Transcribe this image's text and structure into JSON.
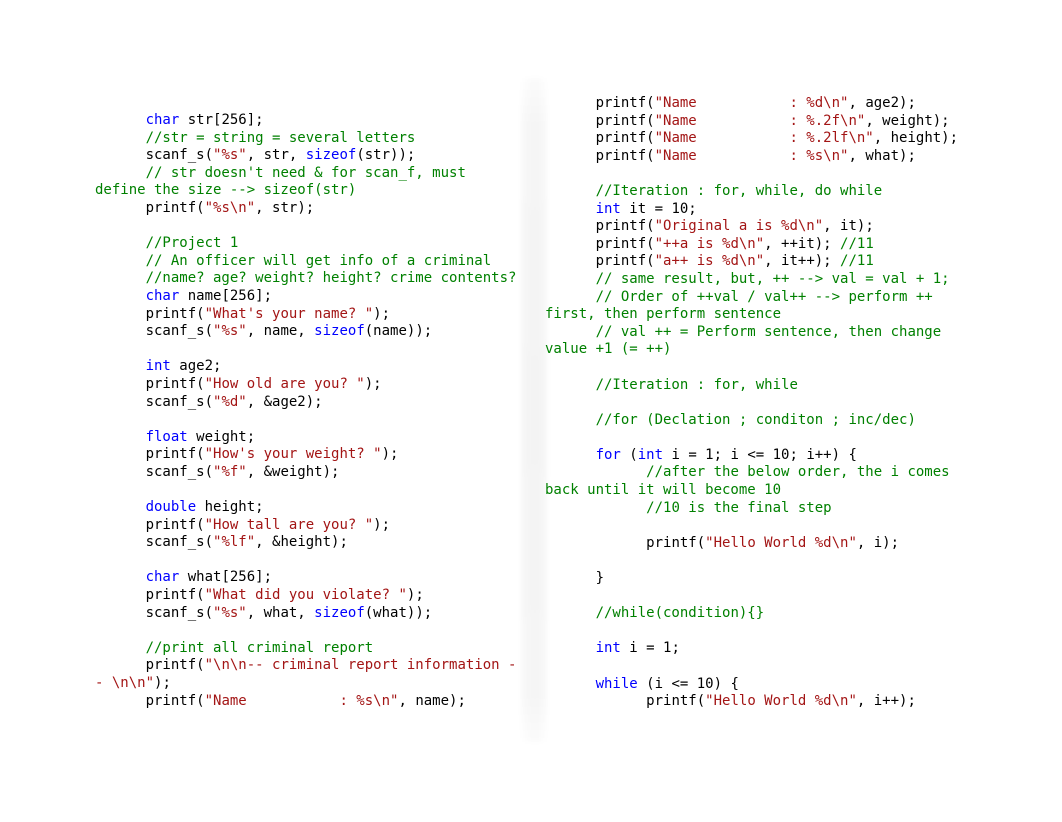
{
  "document": {
    "kind": "c-source-code-listing",
    "language": "C",
    "background_color": "#ffffff",
    "columns": 2
  },
  "theme": {
    "keyword_color": "#0000ff",
    "string_color": "#a31515",
    "comment_color": "#008000",
    "plain_color": "#000000",
    "background_color": "#ffffff"
  },
  "left_column": {
    "lines": [
      [
        {
          "t": "pln",
          "s": "      "
        },
        {
          "t": "kw",
          "s": "char"
        },
        {
          "t": "pln",
          "s": " str[256];"
        }
      ],
      [
        {
          "t": "pln",
          "s": "      "
        },
        {
          "t": "cmt",
          "s": "//str = string = several letters"
        }
      ],
      [
        {
          "t": "pln",
          "s": "      scanf_s("
        },
        {
          "t": "str",
          "s": "\"%s\""
        },
        {
          "t": "pln",
          "s": ", str, "
        },
        {
          "t": "kw",
          "s": "sizeof"
        },
        {
          "t": "pln",
          "s": "(str));"
        }
      ],
      [
        {
          "t": "pln",
          "s": "      "
        },
        {
          "t": "cmt",
          "s": "// str doesn't need & for scan_f, must define the size --> sizeof(str)"
        }
      ],
      [
        {
          "t": "pln",
          "s": "      printf("
        },
        {
          "t": "str",
          "s": "\"%s\\n\""
        },
        {
          "t": "pln",
          "s": ", str);"
        }
      ],
      [
        {
          "t": "pln",
          "s": ""
        }
      ],
      [
        {
          "t": "pln",
          "s": "      "
        },
        {
          "t": "cmt",
          "s": "//Project 1"
        }
      ],
      [
        {
          "t": "pln",
          "s": "      "
        },
        {
          "t": "cmt",
          "s": "// An officer will get info of a criminal"
        }
      ],
      [
        {
          "t": "pln",
          "s": "      "
        },
        {
          "t": "cmt",
          "s": "//name? age? weight? height? crime contents?"
        }
      ],
      [
        {
          "t": "pln",
          "s": "      "
        },
        {
          "t": "kw",
          "s": "char"
        },
        {
          "t": "pln",
          "s": " name[256];"
        }
      ],
      [
        {
          "t": "pln",
          "s": "      printf("
        },
        {
          "t": "str",
          "s": "\"What's your name? \""
        },
        {
          "t": "pln",
          "s": ");"
        }
      ],
      [
        {
          "t": "pln",
          "s": "      scanf_s("
        },
        {
          "t": "str",
          "s": "\"%s\""
        },
        {
          "t": "pln",
          "s": ", name, "
        },
        {
          "t": "kw",
          "s": "sizeof"
        },
        {
          "t": "pln",
          "s": "(name));"
        }
      ],
      [
        {
          "t": "pln",
          "s": ""
        }
      ],
      [
        {
          "t": "pln",
          "s": "      "
        },
        {
          "t": "kw",
          "s": "int"
        },
        {
          "t": "pln",
          "s": " age2;"
        }
      ],
      [
        {
          "t": "pln",
          "s": "      printf("
        },
        {
          "t": "str",
          "s": "\"How old are you? \""
        },
        {
          "t": "pln",
          "s": ");"
        }
      ],
      [
        {
          "t": "pln",
          "s": "      scanf_s("
        },
        {
          "t": "str",
          "s": "\"%d\""
        },
        {
          "t": "pln",
          "s": ", &age2);"
        }
      ],
      [
        {
          "t": "pln",
          "s": ""
        }
      ],
      [
        {
          "t": "pln",
          "s": "      "
        },
        {
          "t": "kw",
          "s": "float"
        },
        {
          "t": "pln",
          "s": " weight;"
        }
      ],
      [
        {
          "t": "pln",
          "s": "      printf("
        },
        {
          "t": "str",
          "s": "\"How's your weight? \""
        },
        {
          "t": "pln",
          "s": ");"
        }
      ],
      [
        {
          "t": "pln",
          "s": "      scanf_s("
        },
        {
          "t": "str",
          "s": "\"%f\""
        },
        {
          "t": "pln",
          "s": ", &weight);"
        }
      ],
      [
        {
          "t": "pln",
          "s": ""
        }
      ],
      [
        {
          "t": "pln",
          "s": "      "
        },
        {
          "t": "kw",
          "s": "double"
        },
        {
          "t": "pln",
          "s": " height;"
        }
      ],
      [
        {
          "t": "pln",
          "s": "      printf("
        },
        {
          "t": "str",
          "s": "\"How tall are you? \""
        },
        {
          "t": "pln",
          "s": ");"
        }
      ],
      [
        {
          "t": "pln",
          "s": "      scanf_s("
        },
        {
          "t": "str",
          "s": "\"%lf\""
        },
        {
          "t": "pln",
          "s": ", &height);"
        }
      ],
      [
        {
          "t": "pln",
          "s": ""
        }
      ],
      [
        {
          "t": "pln",
          "s": "      "
        },
        {
          "t": "kw",
          "s": "char"
        },
        {
          "t": "pln",
          "s": " what[256];"
        }
      ],
      [
        {
          "t": "pln",
          "s": "      printf("
        },
        {
          "t": "str",
          "s": "\"What did you violate? \""
        },
        {
          "t": "pln",
          "s": ");"
        }
      ],
      [
        {
          "t": "pln",
          "s": "      scanf_s("
        },
        {
          "t": "str",
          "s": "\"%s\""
        },
        {
          "t": "pln",
          "s": ", what, "
        },
        {
          "t": "kw",
          "s": "sizeof"
        },
        {
          "t": "pln",
          "s": "(what));"
        }
      ],
      [
        {
          "t": "pln",
          "s": ""
        }
      ],
      [
        {
          "t": "pln",
          "s": "      "
        },
        {
          "t": "cmt",
          "s": "//print all criminal report"
        }
      ],
      [
        {
          "t": "pln",
          "s": "      printf("
        },
        {
          "t": "str",
          "s": "\"\\n\\n-- criminal report information -- \\n\\n\""
        },
        {
          "t": "pln",
          "s": ");"
        }
      ],
      [
        {
          "t": "pln",
          "s": "      printf("
        },
        {
          "t": "str",
          "s": "\"Name           : %s\\n\""
        },
        {
          "t": "pln",
          "s": ", name);"
        }
      ]
    ]
  },
  "right_column": {
    "lines": [
      [
        {
          "t": "pln",
          "s": "      printf("
        },
        {
          "t": "str",
          "s": "\"Name           : %d\\n\""
        },
        {
          "t": "pln",
          "s": ", age2);"
        }
      ],
      [
        {
          "t": "pln",
          "s": "      printf("
        },
        {
          "t": "str",
          "s": "\"Name           : %.2f\\n\""
        },
        {
          "t": "pln",
          "s": ", weight);"
        }
      ],
      [
        {
          "t": "pln",
          "s": "      printf("
        },
        {
          "t": "str",
          "s": "\"Name           : %.2lf\\n\""
        },
        {
          "t": "pln",
          "s": ", height);"
        }
      ],
      [
        {
          "t": "pln",
          "s": "      printf("
        },
        {
          "t": "str",
          "s": "\"Name           : %s\\n\""
        },
        {
          "t": "pln",
          "s": ", what);"
        }
      ],
      [
        {
          "t": "pln",
          "s": ""
        }
      ],
      [
        {
          "t": "pln",
          "s": "      "
        },
        {
          "t": "cmt",
          "s": "//Iteration : for, while, do while"
        }
      ],
      [
        {
          "t": "pln",
          "s": "      "
        },
        {
          "t": "kw",
          "s": "int"
        },
        {
          "t": "pln",
          "s": " it = 10;"
        }
      ],
      [
        {
          "t": "pln",
          "s": "      printf("
        },
        {
          "t": "str",
          "s": "\"Original a is %d\\n\""
        },
        {
          "t": "pln",
          "s": ", it);"
        }
      ],
      [
        {
          "t": "pln",
          "s": "      printf("
        },
        {
          "t": "str",
          "s": "\"++a is %d\\n\""
        },
        {
          "t": "pln",
          "s": ", ++it); "
        },
        {
          "t": "cmt",
          "s": "//11"
        }
      ],
      [
        {
          "t": "pln",
          "s": "      printf("
        },
        {
          "t": "str",
          "s": "\"a++ is %d\\n\""
        },
        {
          "t": "pln",
          "s": ", it++); "
        },
        {
          "t": "cmt",
          "s": "//11"
        }
      ],
      [
        {
          "t": "pln",
          "s": "      "
        },
        {
          "t": "cmt",
          "s": "// same result, but, ++ --> val = val + 1;"
        }
      ],
      [
        {
          "t": "pln",
          "s": "      "
        },
        {
          "t": "cmt",
          "s": "// Order of ++val / val++ --> perform ++ first, then perform sentence"
        }
      ],
      [
        {
          "t": "pln",
          "s": "      "
        },
        {
          "t": "cmt",
          "s": "// val ++ = Perform sentence, then change value +1 (= ++)"
        }
      ],
      [
        {
          "t": "pln",
          "s": ""
        }
      ],
      [
        {
          "t": "pln",
          "s": "      "
        },
        {
          "t": "cmt",
          "s": "//Iteration : for, while"
        }
      ],
      [
        {
          "t": "pln",
          "s": ""
        }
      ],
      [
        {
          "t": "pln",
          "s": "      "
        },
        {
          "t": "cmt",
          "s": "//for (Declation ; conditon ; inc/dec)"
        }
      ],
      [
        {
          "t": "pln",
          "s": ""
        }
      ],
      [
        {
          "t": "pln",
          "s": "      "
        },
        {
          "t": "kw",
          "s": "for"
        },
        {
          "t": "pln",
          "s": " ("
        },
        {
          "t": "kw",
          "s": "int"
        },
        {
          "t": "pln",
          "s": " i = 1; i <= 10; i++) {"
        }
      ],
      [
        {
          "t": "pln",
          "s": "            "
        },
        {
          "t": "cmt",
          "s": "//after the below order, the i comes back until it will become 10"
        }
      ],
      [
        {
          "t": "pln",
          "s": "            "
        },
        {
          "t": "cmt",
          "s": "//10 is the final step"
        }
      ],
      [
        {
          "t": "pln",
          "s": ""
        }
      ],
      [
        {
          "t": "pln",
          "s": "            printf("
        },
        {
          "t": "str",
          "s": "\"Hello World %d\\n\""
        },
        {
          "t": "pln",
          "s": ", i);"
        }
      ],
      [
        {
          "t": "pln",
          "s": ""
        }
      ],
      [
        {
          "t": "pln",
          "s": "      }"
        }
      ],
      [
        {
          "t": "pln",
          "s": ""
        }
      ],
      [
        {
          "t": "pln",
          "s": "      "
        },
        {
          "t": "cmt",
          "s": "//while(condition){}"
        }
      ],
      [
        {
          "t": "pln",
          "s": ""
        }
      ],
      [
        {
          "t": "pln",
          "s": "      "
        },
        {
          "t": "kw",
          "s": "int"
        },
        {
          "t": "pln",
          "s": " i = 1;"
        }
      ],
      [
        {
          "t": "pln",
          "s": ""
        }
      ],
      [
        {
          "t": "pln",
          "s": "      "
        },
        {
          "t": "kw",
          "s": "while"
        },
        {
          "t": "pln",
          "s": " (i <= 10) {"
        }
      ],
      [
        {
          "t": "pln",
          "s": "            printf("
        },
        {
          "t": "str",
          "s": "\"Hello World %d\\n\""
        },
        {
          "t": "pln",
          "s": ", i++);"
        }
      ]
    ]
  }
}
